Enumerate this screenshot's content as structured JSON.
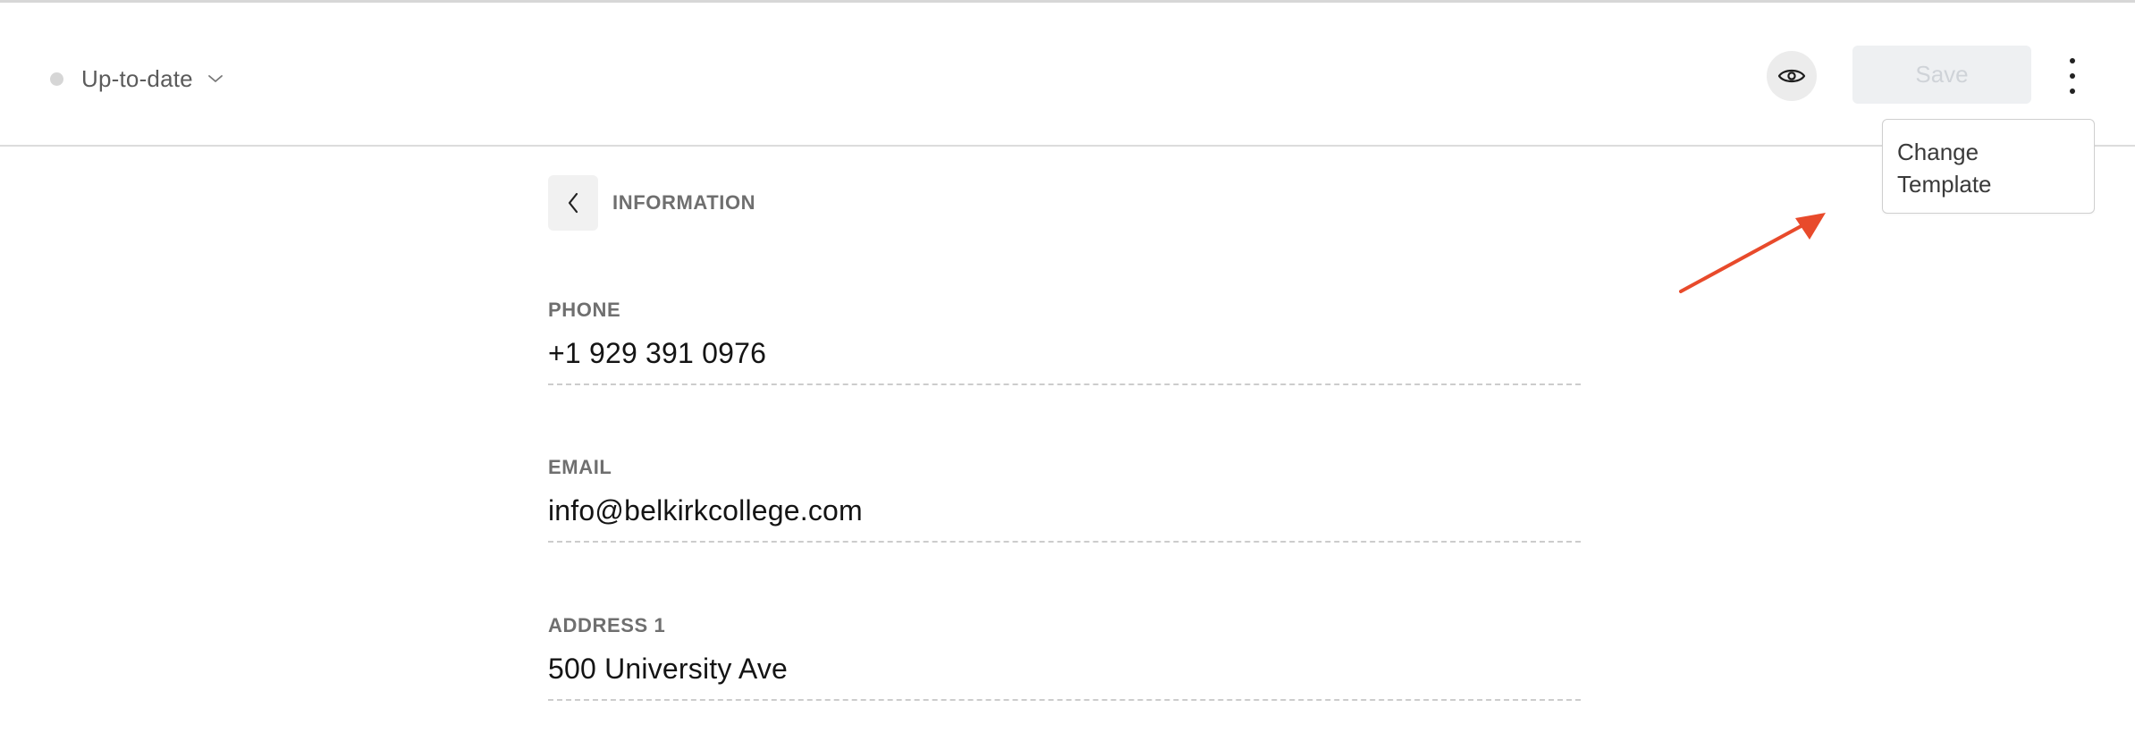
{
  "header": {
    "status_label": "Up-to-date",
    "status_icon": "chevron-down-icon",
    "preview_icon": "eye-icon",
    "save_label": "Save",
    "more_icon": "more-vertical-icon"
  },
  "menu": {
    "items": [
      {
        "label": "Change Template"
      }
    ]
  },
  "annotation": {
    "arrow_color": "#e84a2b"
  },
  "section": {
    "back_icon": "chevron-left-icon",
    "title": "INFORMATION"
  },
  "fields": [
    {
      "label": "PHONE",
      "value": "+1 929 391 0976"
    },
    {
      "label": "EMAIL",
      "value": "info@belkirkcollege.com"
    },
    {
      "label": "ADDRESS 1",
      "value": "500 University Ave"
    }
  ],
  "colors": {
    "status_dot": "#d6d6d6",
    "save_disabled_bg": "#eef0f2",
    "save_disabled_text": "#cfd3d8"
  }
}
